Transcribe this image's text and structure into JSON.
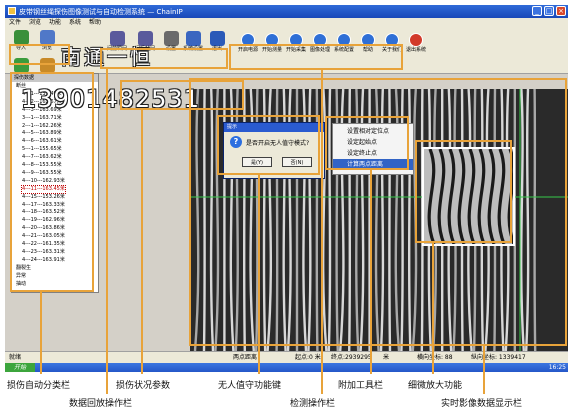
{
  "window": {
    "title": "皮带钢丝绳探伤图像测试与自动检测系统 — ChainIP",
    "minimize": "_",
    "maximize": "□",
    "close": "×"
  },
  "menu": [
    "文件",
    "浏览",
    "功能",
    "系统",
    "帮助"
  ],
  "toolbar_left": [
    {
      "label": "导入",
      "icon": "import-icon",
      "color": "#3a8f3a"
    },
    {
      "label": "浏览",
      "icon": "browse-icon",
      "color": "#5078c8"
    },
    {
      "label": "播放",
      "icon": "play-icon",
      "color": "#3c9c3c"
    },
    {
      "label": "暂停",
      "icon": "pause-icon",
      "color": "#c88a28"
    }
  ],
  "toolbar_mid": [
    {
      "label": "间前瞬间",
      "icon": "prev-frame-icon",
      "color": "#5a5a9c"
    },
    {
      "label": "间后帧间",
      "icon": "next-frame-icon",
      "color": "#5a5a9c"
    },
    {
      "label": "设置",
      "icon": "settings-icon",
      "color": "#6a6a6a"
    },
    {
      "label": "系统设置",
      "icon": "system-settings-icon",
      "color": "#3a66c0"
    },
    {
      "label": "退出",
      "icon": "exit-icon",
      "color": "#2a5ab8"
    }
  ],
  "toolbar_detect": [
    {
      "label": "开启电源",
      "color": "#2f6fd6"
    },
    {
      "label": "开始测量",
      "color": "#2f6fd6"
    },
    {
      "label": "开始采集",
      "color": "#2f6fd6"
    },
    {
      "label": "图像处理",
      "color": "#2f6fd6"
    },
    {
      "label": "系统配置",
      "color": "#2f6fd6"
    },
    {
      "label": "帮助",
      "color": "#2f6fd6"
    },
    {
      "label": "关于我们",
      "color": "#2f6fd6"
    },
    {
      "label": "退出系统",
      "color": "#d23a2a"
    }
  ],
  "tree": {
    "title": "探伤数据",
    "items": [
      "断丝",
      "4---1---131.49米",
      "4---2---162.67米",
      "4---3---163.69米",
      "3---1---163.71米",
      "2---1---162.26米",
      "4---5---163.89米",
      "4---6---163.61米",
      "5---1---155.65米",
      "4---7---163.62米",
      "4---8---153.55米",
      "4---9---163.55米",
      "4---10---162.93米",
      "4---11---163.45米",
      "4---15---153.26米",
      "4---17---163.33米",
      "4---18---163.52米",
      "4---19---162.96米",
      "4---20---163.86米",
      "4---21---163.05米",
      "4---22---161.35米",
      "4---23---163.31米",
      "4---24---163.91米",
      "翻裂生",
      "异常",
      "抽动"
    ],
    "selected_index": 13
  },
  "dialog": {
    "title": "提示",
    "icon": "question-icon",
    "message": "是否开启无人值守模式?",
    "yes": "是(Y)",
    "no": "否(N)"
  },
  "context_menu": {
    "items": [
      "设置相对定位点",
      "设定起始点",
      "设定终止点",
      "计算两点距离"
    ],
    "highlighted_index": 3
  },
  "status": {
    "left": "就绪",
    "distance_label": "两点距离",
    "distance_value": "起点:0 米",
    "endpoint": "终点:2939295",
    "unit": "米",
    "cursor_label": "横向坐标: 88",
    "vertical_label": "纵向坐标: 1339417"
  },
  "taskbar": {
    "start": "开始",
    "clock": "16:25"
  },
  "watermark": {
    "name": "南通一恒",
    "phone": "13901482531"
  },
  "captions": [
    {
      "text": "损伤自动分类栏"
    },
    {
      "text": "损伤状况参数"
    },
    {
      "text": "无人值守功能键"
    },
    {
      "text": "附加工具栏"
    },
    {
      "text": "细微放大功能"
    },
    {
      "text": "数据回放操作栏"
    },
    {
      "text": "检测操作栏"
    },
    {
      "text": "实时影像数据显示栏"
    }
  ],
  "colors": {
    "annotation": "#e8a33a",
    "title_bar": "#2f6ad8",
    "guide_line": "#36c94a"
  }
}
